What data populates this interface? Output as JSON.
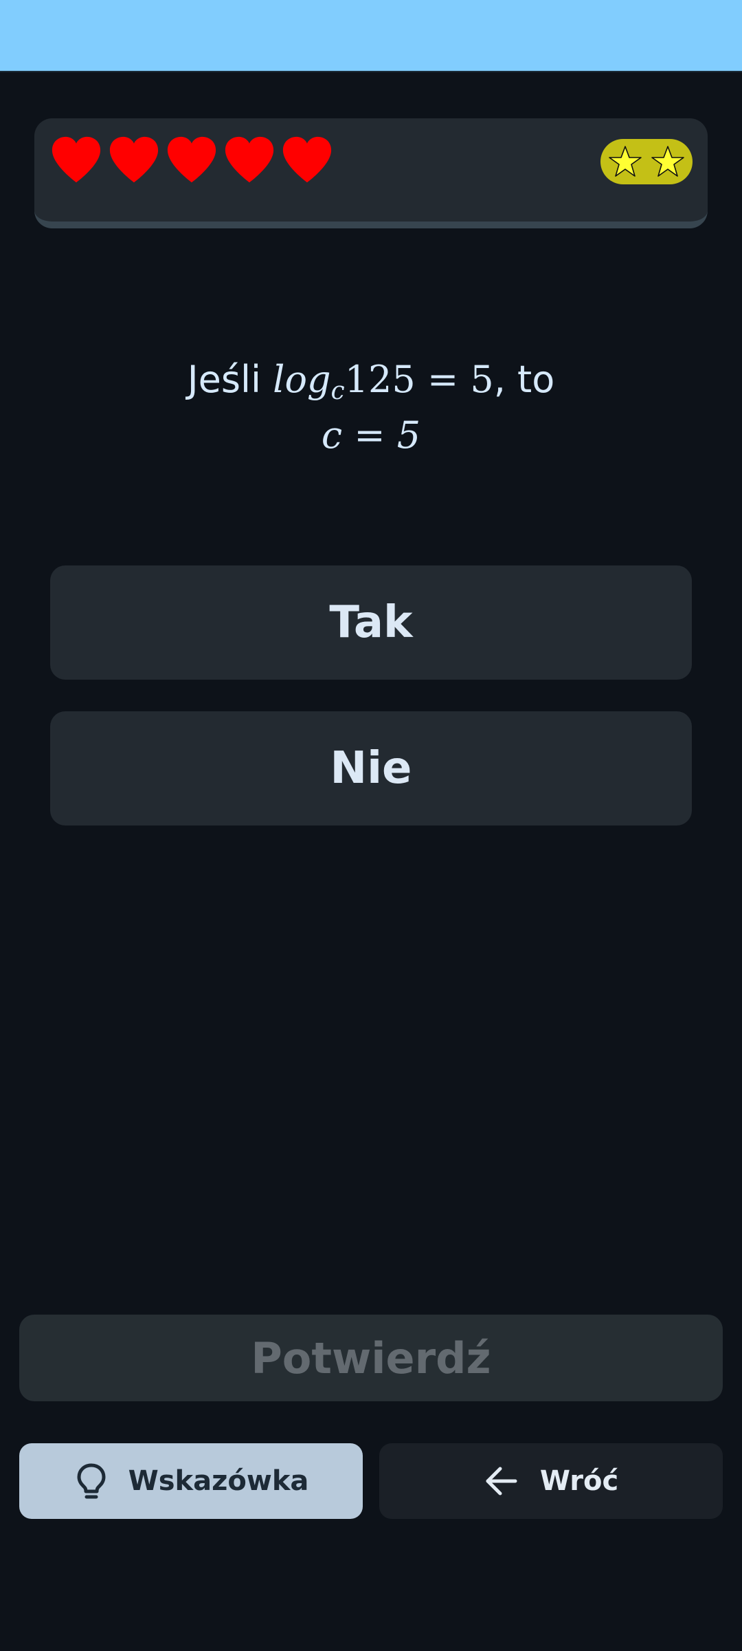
{
  "lives": {
    "count": 5,
    "icon": "heart-icon",
    "color": "#ff0000"
  },
  "stars": {
    "count": 2,
    "icon": "star-icon",
    "pill_color": "#c4c016",
    "star_color": "#ffff33"
  },
  "question": {
    "prefix": "Jeśli ",
    "log_label": "log",
    "log_base": "c",
    "equation_rest": "125 = 5",
    "suffix": ", to",
    "line2": "c = 5"
  },
  "answers": {
    "yes_label": "Tak",
    "no_label": "Nie"
  },
  "confirm": {
    "label": "Potwierdź",
    "enabled": false
  },
  "footer": {
    "hint_label": "Wskazówka",
    "hint_icon": "lightbulb-icon",
    "back_label": "Wróć",
    "back_icon": "arrow-left-icon"
  },
  "colors": {
    "status_bar": "#81cdfe",
    "background": "#0d1219",
    "card": "#232a31",
    "hint_button": "#b8cadb"
  }
}
